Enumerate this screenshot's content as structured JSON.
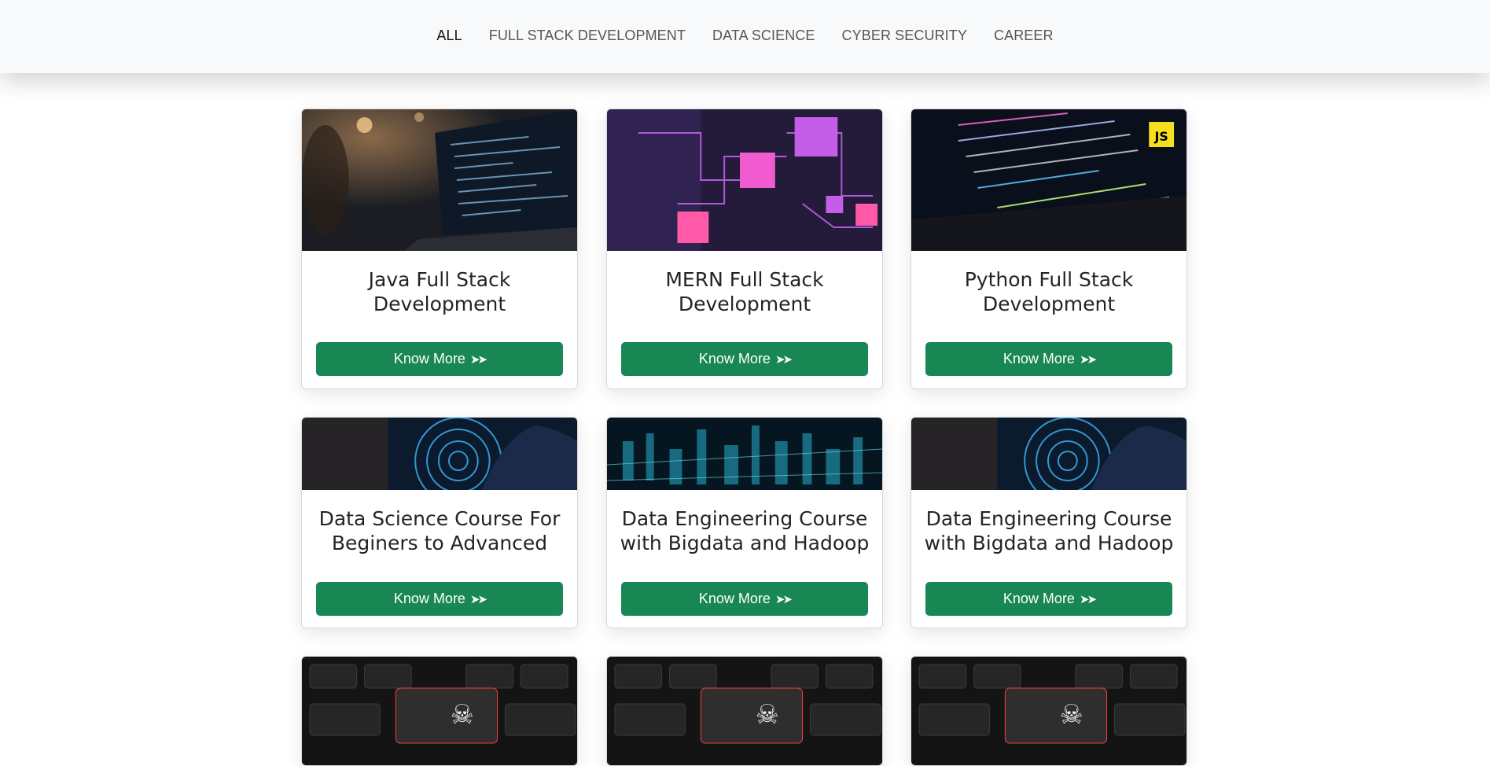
{
  "nav": {
    "items": [
      {
        "label": "ALL",
        "active": true
      },
      {
        "label": "FULL STACK DEVELOPMENT",
        "active": false
      },
      {
        "label": "DATA SCIENCE",
        "active": false
      },
      {
        "label": "CYBER SECURITY",
        "active": false
      },
      {
        "label": "CAREER",
        "active": false
      }
    ]
  },
  "cards": [
    {
      "title": "Java Full Stack Development",
      "button": "Know More",
      "image": "laptop-code-image"
    },
    {
      "title": "MERN Full Stack Development",
      "button": "Know More",
      "image": "network-cubes-image"
    },
    {
      "title": "Python Full Stack Development",
      "button": "Know More",
      "image": "js-code-screen-image",
      "badge": "JS"
    },
    {
      "title": "Data Science Course For Beginers to Advanced",
      "button": "Know More",
      "image": "tech-hand-image"
    },
    {
      "title": "Data Engineering Course with Bigdata and Hadoop",
      "button": "Know More",
      "image": "data-city-image"
    },
    {
      "title": "Data Engineering Course with Bigdata and Hadoop",
      "button": "Know More",
      "image": "tech-hand-image"
    },
    {
      "image": "skull-keyboard-image"
    },
    {
      "image": "skull-keyboard-image"
    },
    {
      "image": "skull-keyboard-image"
    }
  ],
  "colors": {
    "accent": "#198754",
    "nav_bg": "#f8f9fa"
  }
}
